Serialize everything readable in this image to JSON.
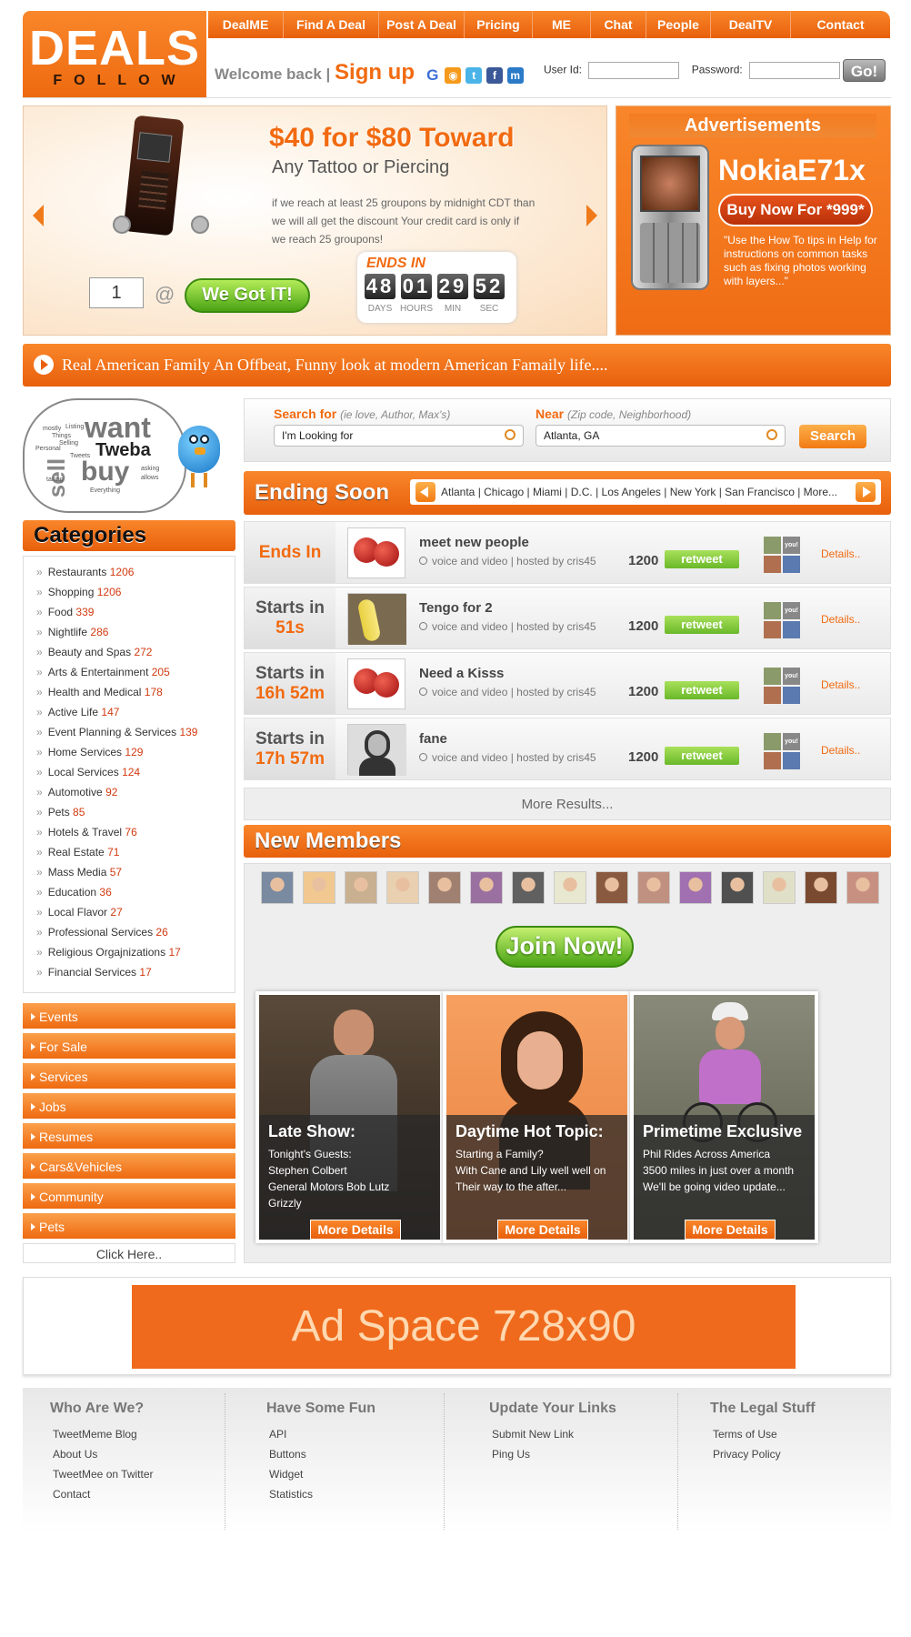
{
  "header": {
    "logo_big": "DEALS",
    "logo_small": "FOLLOW",
    "nav": [
      "DealME",
      "Find A Deal",
      "Post A Deal",
      "Pricing",
      "ME",
      "Chat",
      "People",
      "DealTV",
      "Contact"
    ],
    "welcome": "Welcome back |",
    "signup": "Sign up",
    "userid_label": "User Id:",
    "password_label": "Password:",
    "go": "Go!",
    "social_icons": [
      "google-icon",
      "rss-icon",
      "twitter-icon",
      "facebook-icon",
      "myspace-icon"
    ]
  },
  "hero": {
    "title": "$40 for $80 Toward",
    "subtitle": "Any Tattoo or Piercing",
    "description": "if we reach at least 25 groupons by midnight CDT than we will all get the discount Your credit card is only if we reach 25 groupons!",
    "quantity": "1",
    "at": "@",
    "cta": "We Got IT!",
    "ends_label": "ENDS IN",
    "countdown": [
      {
        "value": "48",
        "unit": "DAYS"
      },
      {
        "value": "01",
        "unit": "HOURS"
      },
      {
        "value": "29",
        "unit": "MIN"
      },
      {
        "value": "52",
        "unit": "SEC"
      }
    ]
  },
  "ad": {
    "title": "Advertisements",
    "product": "NokiaE71x",
    "cta": "Buy Now For *999*",
    "quote": "\"Use the How To tips in Help for instructions on common tasks such as fixing photos working with layers...\""
  },
  "marquee": "Real American Family An Offbeat, Funny look at modern American Famaily life....",
  "bubble": {
    "want": "want",
    "tweba": "Tweba",
    "buy": "buy",
    "sell": "sell",
    "small_words": [
      "Listing",
      "Personal",
      "Selling",
      "asking",
      "allows",
      "Everything",
      "Things",
      "Tweets",
      "mostly",
      "taking"
    ]
  },
  "search": {
    "for_label": "Search for",
    "for_hint": "(ie love, Author, Max's)",
    "for_value": "I'm Looking for",
    "near_label": "Near",
    "near_hint": "(Zip code, Neighborhood)",
    "near_value": "Atlanta, GA",
    "button": "Search"
  },
  "ending_soon": {
    "title": "Ending Soon",
    "cities": "Atlanta | Chicago | Miami | D.C. | Los Angeles | New York | San Francisco | More...",
    "rows": [
      {
        "when_a": "Ends In",
        "when_b": "",
        "name": "meet new people",
        "meta": "voice and video |   hosted by cris45",
        "points": "1200",
        "retweet": "retweet",
        "details": "Details..",
        "thumb": "tomato"
      },
      {
        "when_a": "Starts in",
        "when_b": "51s",
        "name": "Tengo for 2",
        "meta": "voice and video |   hosted by cris45",
        "points": "1200",
        "retweet": "retweet",
        "details": "Details..",
        "thumb": "banana"
      },
      {
        "when_a": "Starts in",
        "when_b": "16h 52m",
        "name": "Need a Kisss",
        "meta": "voice and video |   hosted by cris45",
        "points": "1200",
        "retweet": "retweet",
        "details": "Details..",
        "thumb": "tomato"
      },
      {
        "when_a": "Starts in",
        "when_b": "17h 57m",
        "name": "fane",
        "meta": "voice and video |   hosted by cris45",
        "points": "1200",
        "retweet": "retweet",
        "details": "Details..",
        "thumb": "portrait"
      }
    ],
    "avatar_you": "you!",
    "more": "More Results..."
  },
  "new_members": {
    "title": "New Members",
    "join": "Join Now!",
    "cards": [
      {
        "title": "Late Show:",
        "body": [
          "Tonight's Guests:",
          "Stephen Colbert",
          "General Motors Bob Lutz",
          "Grizzly"
        ],
        "cta": "More Details"
      },
      {
        "title": "Daytime Hot Topic:",
        "body": [
          "Starting a Family?",
          "With Cane and Lily well well on",
          "Their way to the after..."
        ],
        "cta": "More Details"
      },
      {
        "title": "Primetime Exclusive",
        "body": [
          "Phil Rides Across America",
          "3500 miles in just over a month",
          "We'll be going video update..."
        ],
        "cta": "More Details"
      }
    ]
  },
  "categories": {
    "title": "Categories",
    "items": [
      {
        "label": "Restaurants",
        "count": "1206"
      },
      {
        "label": "Shopping",
        "count": "1206"
      },
      {
        "label": "Food",
        "count": "339"
      },
      {
        "label": "Nightlife",
        "count": "286"
      },
      {
        "label": "Beauty and Spas",
        "count": "272"
      },
      {
        "label": "Arts & Entertainment",
        "count": "205"
      },
      {
        "label": "Health and Medical",
        "count": "178"
      },
      {
        "label": "Active Life",
        "count": "147"
      },
      {
        "label": "Event Planning & Services",
        "count": "139"
      },
      {
        "label": "Home Services",
        "count": "129"
      },
      {
        "label": "Local Services",
        "count": "124"
      },
      {
        "label": "Automotive",
        "count": "92"
      },
      {
        "label": "Pets",
        "count": "85"
      },
      {
        "label": "Hotels & Travel",
        "count": "76"
      },
      {
        "label": "Real Estate",
        "count": "71"
      },
      {
        "label": "Mass Media",
        "count": "57"
      },
      {
        "label": "Education",
        "count": "36"
      },
      {
        "label": "Local Flavor",
        "count": "27"
      },
      {
        "label": "Professional Services",
        "count": "26"
      },
      {
        "label": "Religious Orgajnizations",
        "count": "17"
      },
      {
        "label": "Financial Services",
        "count": "17"
      }
    ]
  },
  "side_buttons": [
    "Events",
    "For Sale",
    "Services",
    "Jobs",
    "Resumes",
    "Cars&Vehicles",
    "Community",
    "Pets"
  ],
  "click_here": "Click Here..",
  "ad_space": "Ad Space 728x90",
  "footer": [
    {
      "heading": "Who Are We?",
      "links": [
        "TweetMeme Blog",
        "About Us",
        "TweetMee on Twitter",
        "Contact"
      ]
    },
    {
      "heading": "Have Some Fun",
      "links": [
        "API",
        "Buttons",
        "Widget",
        "Statistics"
      ]
    },
    {
      "heading": "Update Your Links",
      "links": [
        "Submit New Link",
        "Ping Us"
      ]
    },
    {
      "heading": "The Legal Stuff",
      "links": [
        "Terms of Use",
        "Privacy Policy"
      ]
    }
  ]
}
